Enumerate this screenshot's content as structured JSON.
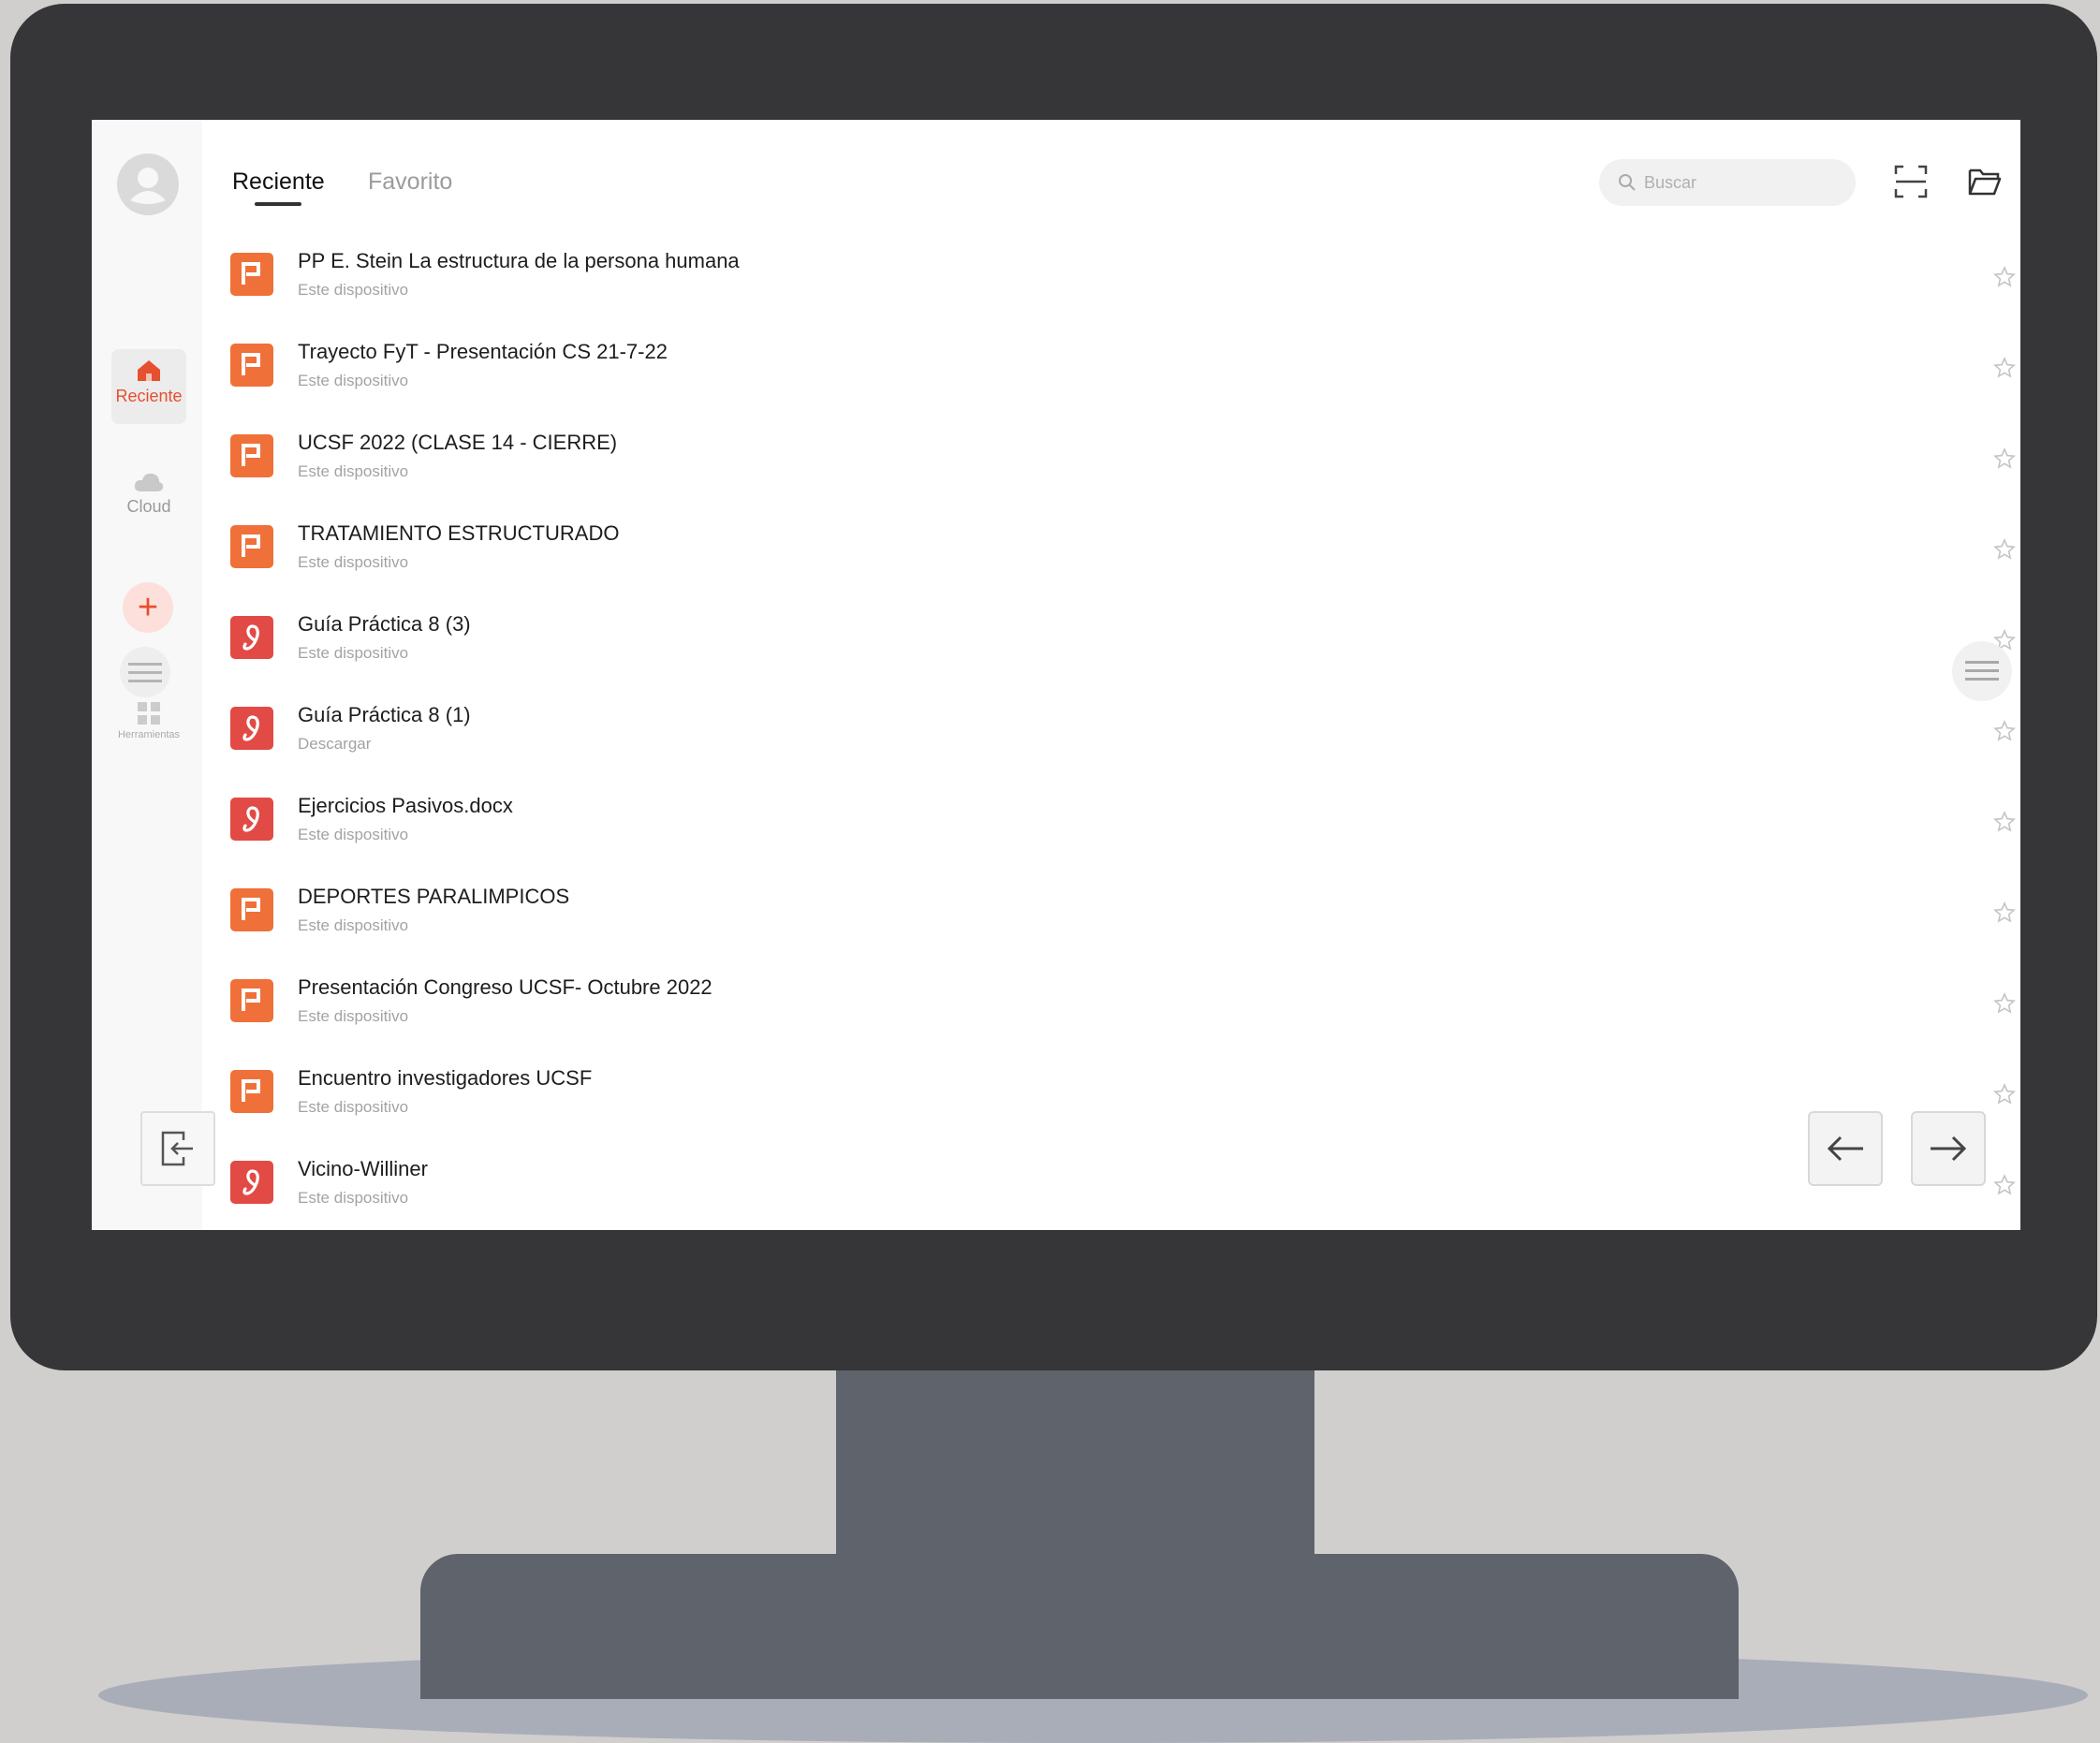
{
  "sidebar": {
    "items": [
      {
        "label": "Reciente",
        "icon": "home-icon",
        "active": true
      },
      {
        "label": "Cloud",
        "icon": "cloud-icon",
        "active": false
      }
    ],
    "add_icon": "plus-icon",
    "tools_label": "Herramientas"
  },
  "header": {
    "tabs": [
      {
        "label": "Reciente",
        "active": true
      },
      {
        "label": "Favorito",
        "active": false
      }
    ],
    "search_placeholder": "Buscar",
    "scan_icon": "scan-icon",
    "folder_icon": "folder-icon"
  },
  "files": [
    {
      "name": "PP E. Stein La estructura de la persona humana",
      "location": "Este dispositivo",
      "type": "ppt"
    },
    {
      "name": "Trayecto FyT - Presentación CS 21-7-22",
      "location": "Este dispositivo",
      "type": "ppt"
    },
    {
      "name": "UCSF 2022 (CLASE 14 - CIERRE)",
      "location": "Este dispositivo",
      "type": "ppt"
    },
    {
      "name": "TRATAMIENTO ESTRUCTURADO",
      "location": "Este dispositivo",
      "type": "ppt"
    },
    {
      "name": "Guía Práctica 8 (3)",
      "location": "Este dispositivo",
      "type": "pdf"
    },
    {
      "name": "Guía Práctica 8 (1)",
      "location": "Descargar",
      "type": "pdf"
    },
    {
      "name": "Ejercicios Pasivos.docx",
      "location": "Este dispositivo",
      "type": "pdf"
    },
    {
      "name": "DEPORTES PARALIMPICOS",
      "location": "Este dispositivo",
      "type": "ppt"
    },
    {
      "name": "Presentación Congreso UCSF- Octubre 2022",
      "location": "Este dispositivo",
      "type": "ppt"
    },
    {
      "name": "Encuentro investigadores UCSF",
      "location": "Este dispositivo",
      "type": "ppt"
    },
    {
      "name": "Vicino-Williner",
      "location": "Este dispositivo",
      "type": "pdf"
    }
  ],
  "colors": {
    "accent": "#e5502f",
    "ppt_icon": "#f0703a",
    "pdf_icon": "#e24a45",
    "monitor": "#363638",
    "stand": "#5f636b"
  },
  "overlay": {
    "exit_icon": "exit-icon",
    "back_icon": "arrow-left-icon",
    "forward_icon": "arrow-right-icon",
    "menu_icon": "hamburger-icon"
  }
}
